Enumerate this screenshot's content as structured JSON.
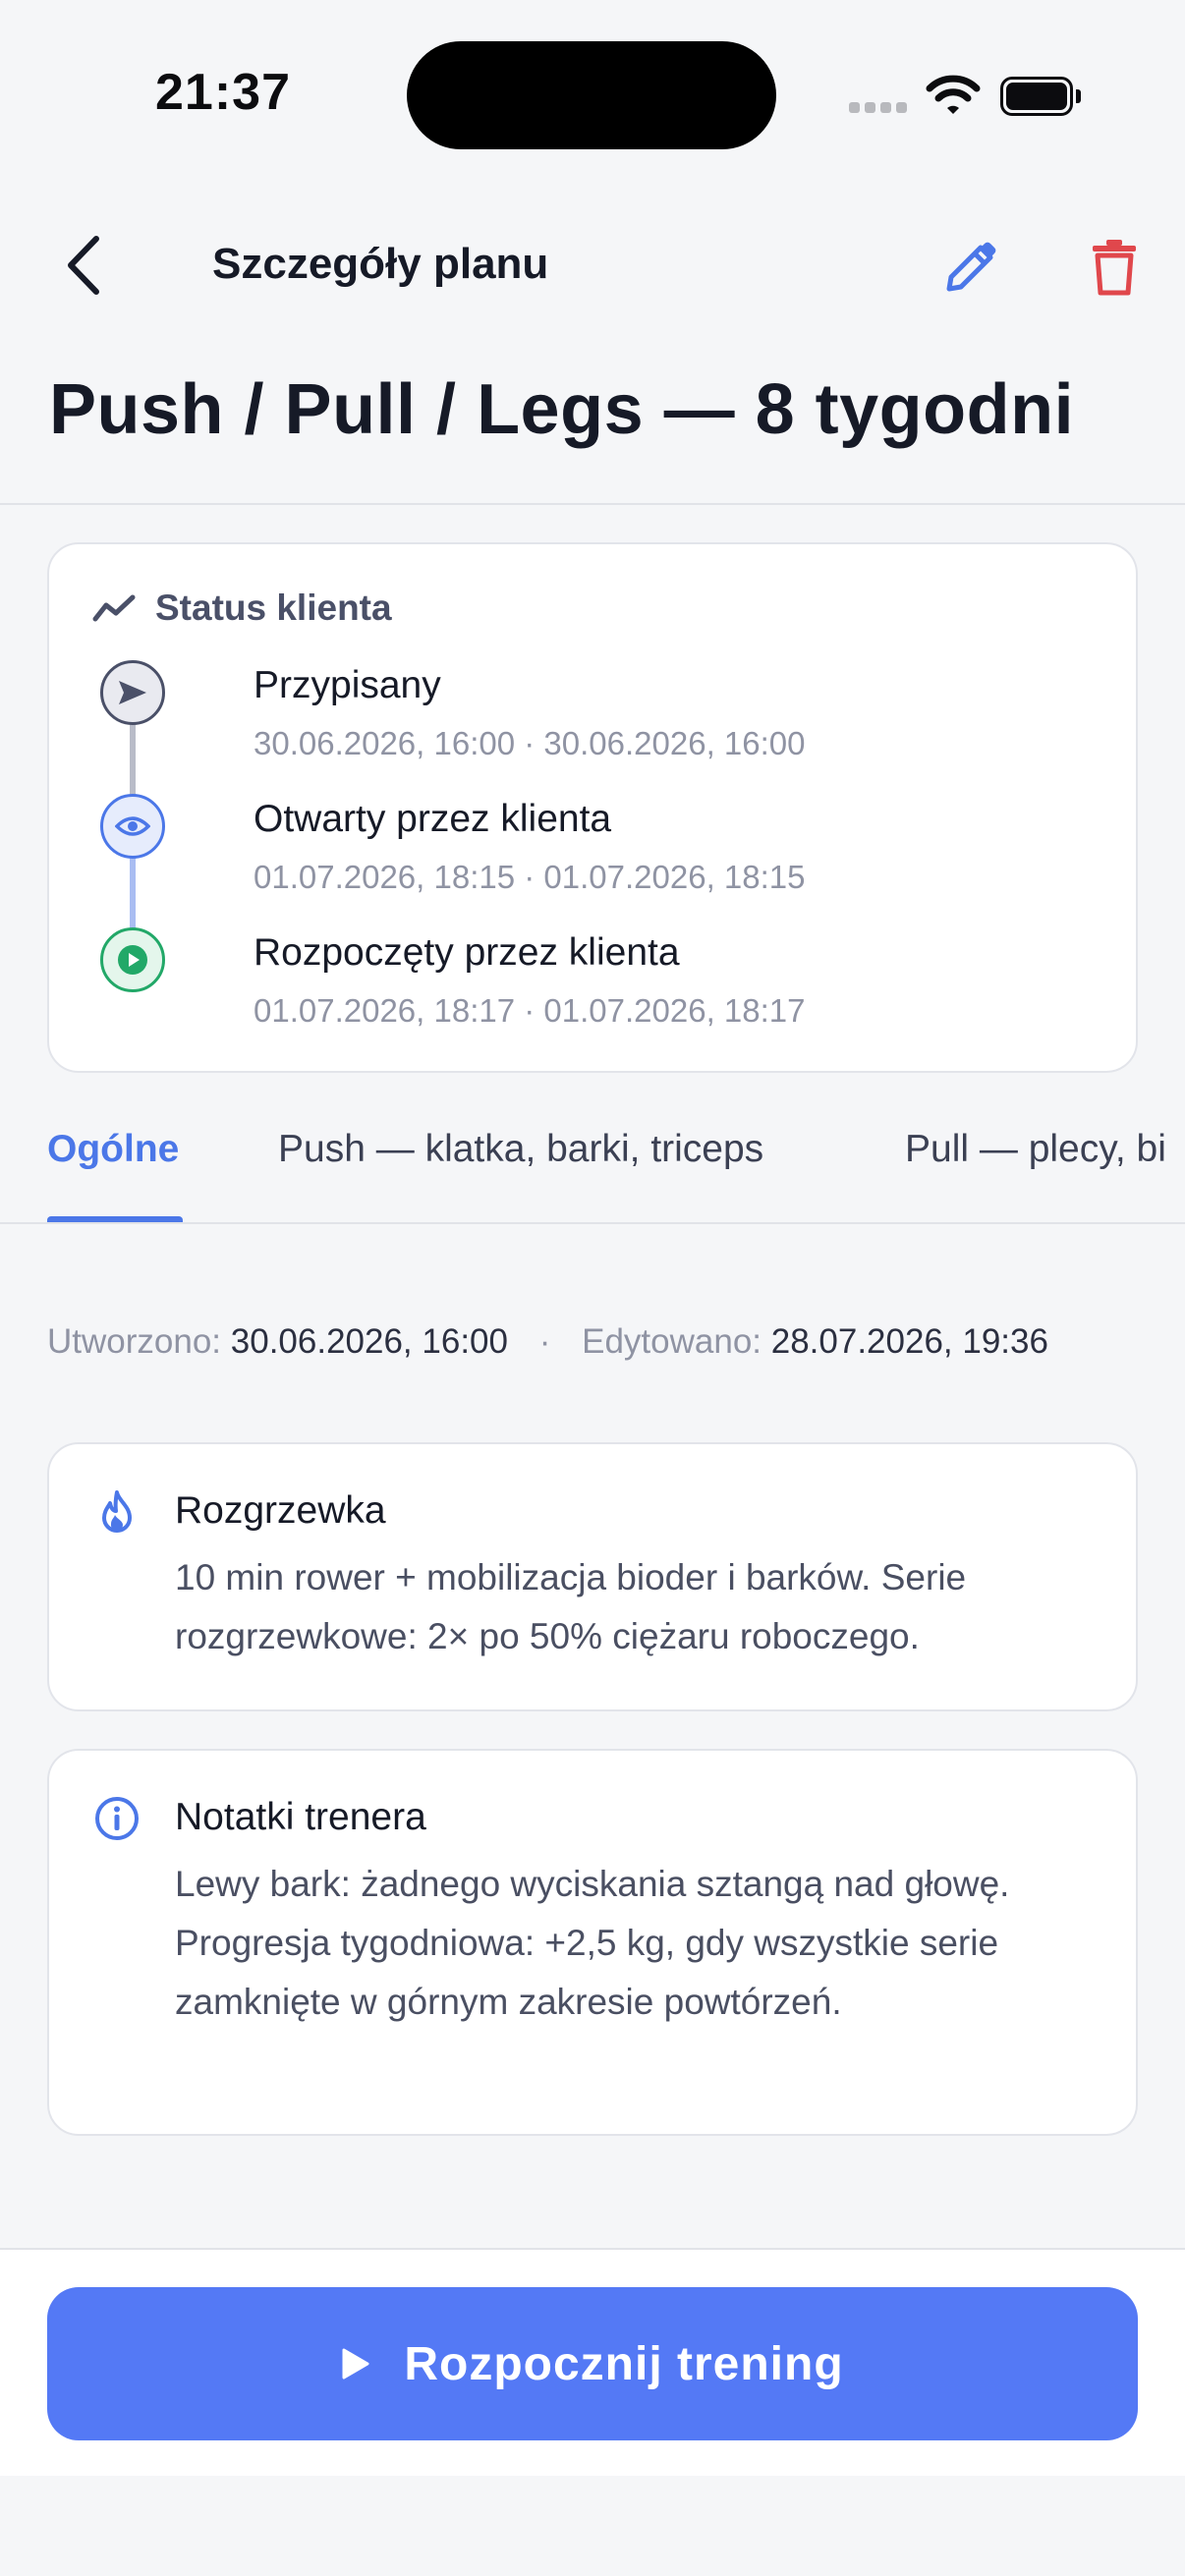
{
  "status_bar": {
    "time": "21:37"
  },
  "nav": {
    "title": "Szczegóły planu"
  },
  "plan": {
    "title": "Push / Pull / Legs — 8 tygodni"
  },
  "client_status": {
    "heading": "Status klienta",
    "events": [
      {
        "title": "Przypisany",
        "dates": "30.06.2026, 16:00 · 30.06.2026, 16:00",
        "icon": "send-icon",
        "color": "#4a5068"
      },
      {
        "title": "Otwarty przez klienta",
        "dates": "01.07.2026, 18:15 · 01.07.2026, 18:15",
        "icon": "eye-icon",
        "color": "#4b77e8"
      },
      {
        "title": "Rozpoczęty przez klienta",
        "dates": "01.07.2026, 18:17 · 01.07.2026, 18:17",
        "icon": "play-icon",
        "color": "#22a868"
      }
    ]
  },
  "tabs": [
    {
      "label": "Ogólne",
      "active": true
    },
    {
      "label": "Push — klatka, barki, triceps",
      "active": false
    },
    {
      "label": "Pull — plecy, bi",
      "active": false
    }
  ],
  "meta": {
    "created_label": "Utworzono:",
    "created_value": "30.06.2026, 16:00",
    "separator": "·",
    "edited_label": "Edytowano:",
    "edited_value": "28.07.2026, 19:36"
  },
  "warmup": {
    "title": "Rozgrzewka",
    "text": "10 min rower + mobilizacja bioder i barków. Serie rozgrzewkowe: 2× po 50% ciężaru roboczego.",
    "icon": "flame-icon"
  },
  "coach_notes": {
    "title": "Notatki trenera",
    "text": "Lewy bark: żadnego wyciskania sztangą nad głowę. Progresja tygodniowa: +2,5 kg, gdy wszystkie serie zamknięte w górnym zakresie powtórzeń.",
    "icon": "info-icon"
  },
  "cta": {
    "label": "Rozpocznij trening"
  },
  "colors": {
    "accent": "#4b77e8",
    "cta": "#5479f5",
    "danger": "#e0474c",
    "success": "#22a868"
  }
}
